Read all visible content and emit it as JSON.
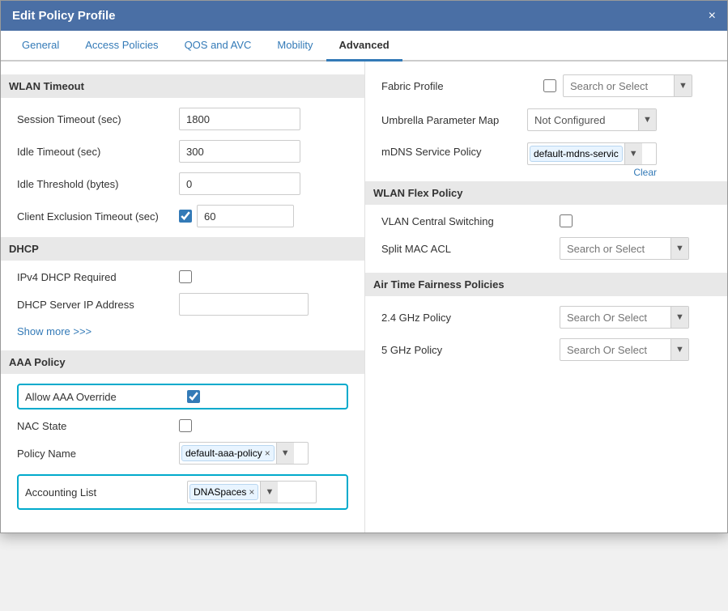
{
  "modal": {
    "title": "Edit Policy Profile",
    "close_label": "×"
  },
  "tabs": [
    {
      "label": "General",
      "active": false
    },
    {
      "label": "Access Policies",
      "active": false
    },
    {
      "label": "QOS and AVC",
      "active": false
    },
    {
      "label": "Mobility",
      "active": false
    },
    {
      "label": "Advanced",
      "active": true
    }
  ],
  "left": {
    "wlan_timeout_header": "WLAN Timeout",
    "session_timeout_label": "Session Timeout (sec)",
    "session_timeout_value": "1800",
    "idle_timeout_label": "Idle Timeout (sec)",
    "idle_timeout_value": "300",
    "idle_threshold_label": "Idle Threshold (bytes)",
    "idle_threshold_value": "0",
    "client_exclusion_label": "Client Exclusion Timeout (sec)",
    "client_exclusion_value": "60",
    "dhcp_header": "DHCP",
    "ipv4_dhcp_label": "IPv4 DHCP Required",
    "dhcp_server_label": "DHCP Server IP Address",
    "show_more_label": "Show more >>>",
    "aaa_policy_header": "AAA Policy",
    "allow_aaa_label": "Allow AAA Override",
    "nac_state_label": "NAC State",
    "policy_name_label": "Policy Name",
    "policy_name_value": "default-aaa-policy",
    "accounting_list_label": "Accounting List",
    "accounting_list_value": "DNASpaces"
  },
  "right": {
    "fabric_profile_label": "Fabric Profile",
    "fabric_placeholder": "Search or Select",
    "umbrella_label": "Umbrella Parameter Map",
    "umbrella_value": "Not Configured",
    "mdns_label": "mDNS Service Policy",
    "mdns_value": "default-mdns-servic",
    "clear_label": "Clear",
    "wlan_flex_header": "WLAN Flex Policy",
    "vlan_switching_label": "VLAN Central Switching",
    "split_mac_label": "Split MAC ACL",
    "split_placeholder": "Search or Select",
    "air_time_header": "Air Time Fairness Policies",
    "ghz24_label": "2.4 GHz Policy",
    "ghz24_placeholder": "Search Or Select",
    "ghz5_label": "5 GHz Policy",
    "ghz5_placeholder": "Search Or Select"
  },
  "icons": {
    "dropdown_arrow": "▼",
    "remove_tag": "×",
    "checked": "✓"
  }
}
